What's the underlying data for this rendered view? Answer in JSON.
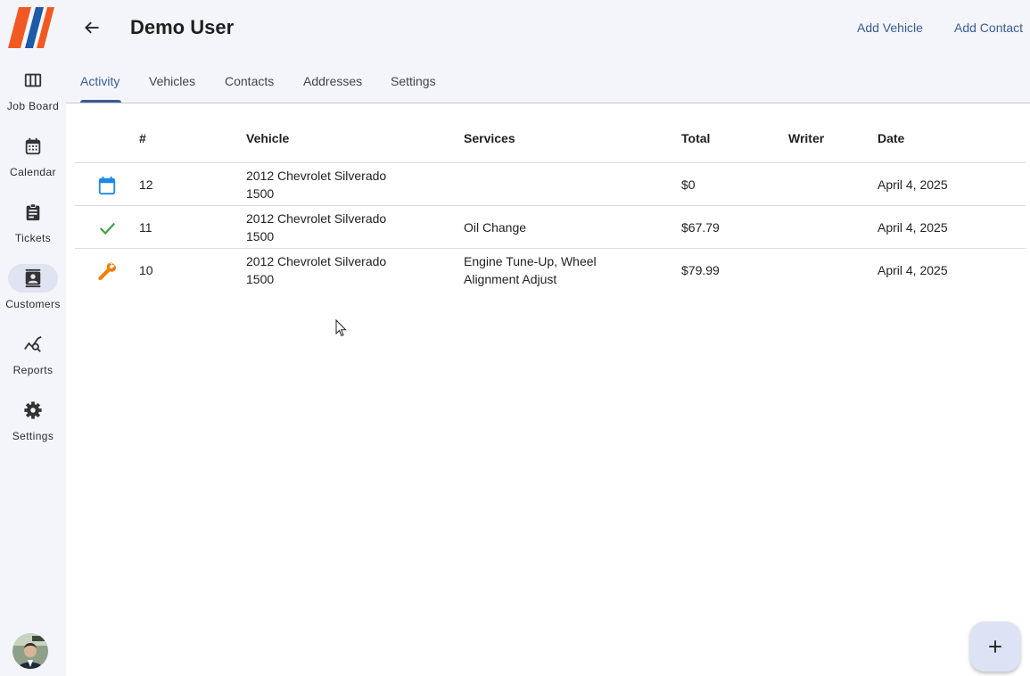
{
  "colors": {
    "accent": "#3a5c92",
    "rail_bg": "#f4f5fb",
    "active_pill": "#dfe3f2",
    "scheduled": "#1e88e5",
    "completed": "#43a047",
    "in_progress": "#f57c00",
    "logo_orange": "#f05a22",
    "logo_blue": "#1d5aa8"
  },
  "sidebar": {
    "items": [
      {
        "label": "Job Board",
        "icon": "view-columns-icon"
      },
      {
        "label": "Calendar",
        "icon": "calendar-icon"
      },
      {
        "label": "Tickets",
        "icon": "clipboard-icon"
      },
      {
        "label": "Customers",
        "icon": "contact-card-icon",
        "active": true
      },
      {
        "label": "Reports",
        "icon": "analytics-search-icon"
      },
      {
        "label": "Settings",
        "icon": "gear-icon"
      }
    ],
    "avatar_icon": "user-avatar"
  },
  "header": {
    "title": "Demo User",
    "back_icon": "arrow-back-icon",
    "actions": [
      "Add Vehicle",
      "Add Contact"
    ]
  },
  "tabs": [
    {
      "label": "Activity",
      "active": true
    },
    {
      "label": "Vehicles"
    },
    {
      "label": "Contacts"
    },
    {
      "label": "Addresses"
    },
    {
      "label": "Settings"
    }
  ],
  "table": {
    "columns": [
      "#",
      "Vehicle",
      "Services",
      "Total",
      "Writer",
      "Date"
    ],
    "rows": [
      {
        "status_icon": "calendar-icon",
        "number": "12",
        "vehicle": "2012 Chevrolet Silverado 1500",
        "services": "",
        "total": "$0",
        "writer": "",
        "date": "April 4, 2025"
      },
      {
        "status_icon": "check-icon",
        "number": "11",
        "vehicle": "2012 Chevrolet Silverado 1500",
        "services": "Oil Change",
        "total": "$67.79",
        "writer": "",
        "date": "April 4, 2025"
      },
      {
        "status_icon": "wrench-icon",
        "number": "10",
        "vehicle": "2012 Chevrolet Silverado 1500",
        "services": "Engine Tune-Up, Wheel Alignment Adjust",
        "total": "$79.99",
        "writer": "",
        "date": "April 4, 2025"
      }
    ]
  },
  "fab": {
    "icon": "plus-icon"
  }
}
